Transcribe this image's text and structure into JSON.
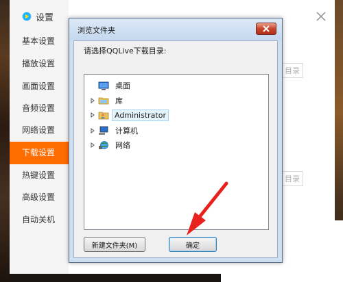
{
  "app": {
    "title": "设置"
  },
  "sidebar": {
    "items": [
      {
        "label": "基本设置",
        "active": false
      },
      {
        "label": "播放设置",
        "active": false
      },
      {
        "label": "画面设置",
        "active": false
      },
      {
        "label": "音频设置",
        "active": false
      },
      {
        "label": "网络设置",
        "active": false
      },
      {
        "label": "下载设置",
        "active": true
      },
      {
        "label": "热键设置",
        "active": false
      },
      {
        "label": "高级设置",
        "active": false
      },
      {
        "label": "自动关机",
        "active": false
      }
    ]
  },
  "background_buttons": {
    "dir_btn_1": "目录",
    "dir_btn_2": "目录"
  },
  "dialog": {
    "title": "浏览文件夹",
    "prompt": "请选择QQLive下载目录:",
    "tree": [
      {
        "label": "桌面",
        "icon": "desktop-icon",
        "expandable": false,
        "selected": false
      },
      {
        "label": "库",
        "icon": "library-folder-icon",
        "expandable": true,
        "selected": false
      },
      {
        "label": "Administrator",
        "icon": "user-folder-icon",
        "expandable": true,
        "selected": true
      },
      {
        "label": "计算机",
        "icon": "computer-icon",
        "expandable": true,
        "selected": false
      },
      {
        "label": "网络",
        "icon": "network-icon",
        "expandable": true,
        "selected": false
      }
    ],
    "new_folder_label": "新建文件夹(M)",
    "ok_label": "确定"
  },
  "colors": {
    "accent": "#ff6c00",
    "arrow": "#e8211d"
  }
}
